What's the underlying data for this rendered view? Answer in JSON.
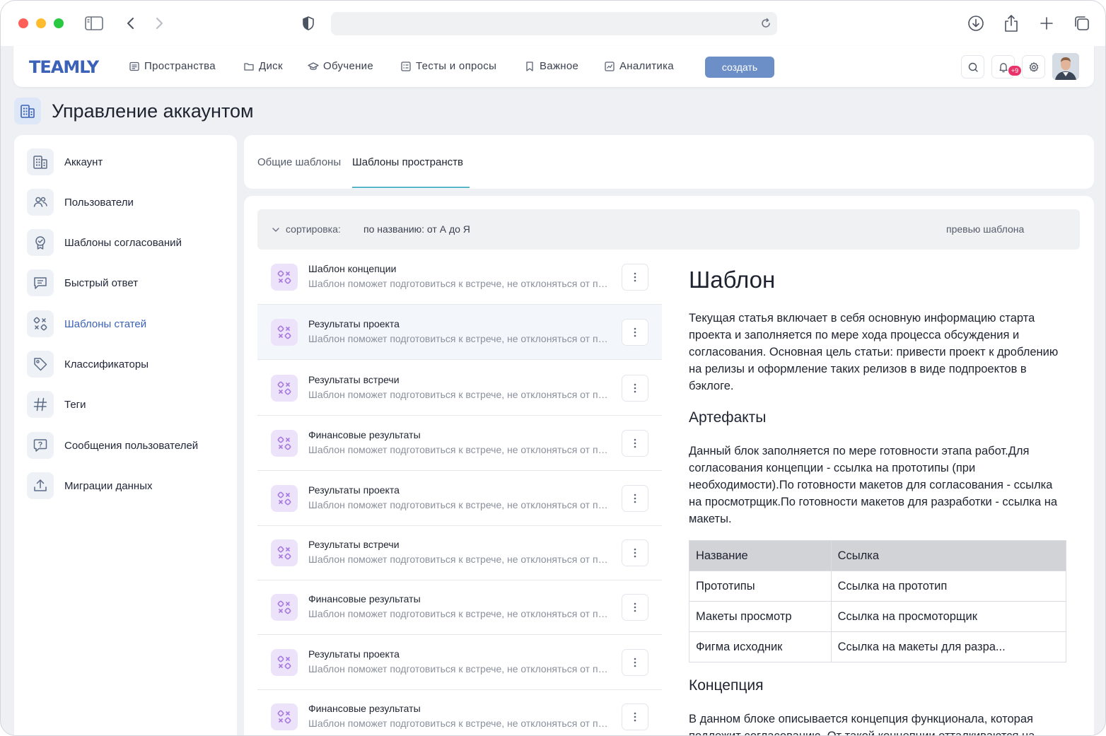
{
  "app": {
    "logo_text": "TEAMLY",
    "nav": [
      {
        "label": "Пространства",
        "icon": "spaces-icon"
      },
      {
        "label": "Диск",
        "icon": "folder-icon"
      },
      {
        "label": "Обучение",
        "icon": "graduation-icon"
      },
      {
        "label": "Тесты и опросы",
        "icon": "tests-icon"
      },
      {
        "label": "Важное",
        "icon": "bookmark-icon"
      },
      {
        "label": "Аналитика",
        "icon": "analytics-icon"
      }
    ],
    "create_label": "создать",
    "notifications_badge": "+9"
  },
  "page": {
    "title": "Управление аккаунтом"
  },
  "sidebar": {
    "items": [
      {
        "label": "Аккаунт",
        "icon": "building-icon"
      },
      {
        "label": "Пользователи",
        "icon": "users-icon"
      },
      {
        "label": "Шаблоны согласований",
        "icon": "approval-badge-icon"
      },
      {
        "label": "Быстрый ответ",
        "icon": "quick-reply-icon"
      },
      {
        "label": "Шаблоны статей",
        "icon": "templates-icon",
        "active": true
      },
      {
        "label": "Классификаторы",
        "icon": "tag-icon"
      },
      {
        "label": "Теги",
        "icon": "hash-icon"
      },
      {
        "label": "Сообщения пользователей",
        "icon": "message-question-icon"
      },
      {
        "label": "Миграции данных",
        "icon": "upload-icon"
      }
    ]
  },
  "tabs": [
    {
      "label": "Общие шаблоны",
      "active": false
    },
    {
      "label": "Шаблоны пространств",
      "active": true
    }
  ],
  "sort": {
    "label": "сортировка:",
    "value": "по названию: от А до Я",
    "preview_label": "превью шаблона"
  },
  "templates": [
    {
      "title": "Шаблон концепции",
      "desc": "Шаблон поможет подготовиться к встрече, не отклоняться от повестки"
    },
    {
      "title": "Результаты проекта",
      "desc": "Шаблон поможет подготовиться к встрече, не отклоняться от повестки",
      "selected": true
    },
    {
      "title": "Результаты встречи",
      "desc": "Шаблон поможет подготовиться к встрече, не отклоняться от повестки"
    },
    {
      "title": "Финансовые результаты",
      "desc": "Шаблон поможет подготовиться к встрече, не отклоняться от повестки"
    },
    {
      "title": "Результаты проекта",
      "desc": "Шаблон поможет подготовиться к встрече, не отклоняться от повестки"
    },
    {
      "title": "Результаты встречи",
      "desc": "Шаблон поможет подготовиться к встрече, не отклоняться от повестки"
    },
    {
      "title": "Финансовые результаты",
      "desc": "Шаблон поможет подготовиться к встрече, не отклоняться от повестки"
    },
    {
      "title": "Результаты проекта",
      "desc": "Шаблон поможет подготовиться к встрече, не отклоняться от повестки"
    },
    {
      "title": "Финансовые результаты",
      "desc": "Шаблон поможет подготовиться к встрече, не отклоняться от повестки"
    }
  ],
  "preview": {
    "title": "Шаблон",
    "intro": "Текущая статья включает в себя основную информацию старта проекта и заполняется по мере хода процесса обсуждения и согласования. Основная цель статьи: привести проект к дроблению на релизы и оформление таких релизов в виде подпроектов в бэклоге.",
    "artifacts_heading": "Артефакты",
    "artifacts_text": "Данный блок заполняется по мере готовности этапа работ.Для согласования концепции - ссылка на прототипы (при необходимости).По готовности макетов для согласования - ссылка на просмотрщик.По готовности макетов для разработки - ссылка на макеты.",
    "table": {
      "headers": [
        "Название",
        "Ссылка"
      ],
      "rows": [
        [
          "Прототипы",
          "Ссылка на прототип"
        ],
        [
          "Макеты просмотр",
          "Ссылка на просмоторщик"
        ],
        [
          "Фигма исходник",
          "Ссылка на макеты для разра..."
        ]
      ]
    },
    "concept_heading": "Концепция",
    "concept_text": "В данном блоке описывается концепция функционала, которая подлежит согласованию. От такой концепции отталкиваются на"
  }
}
